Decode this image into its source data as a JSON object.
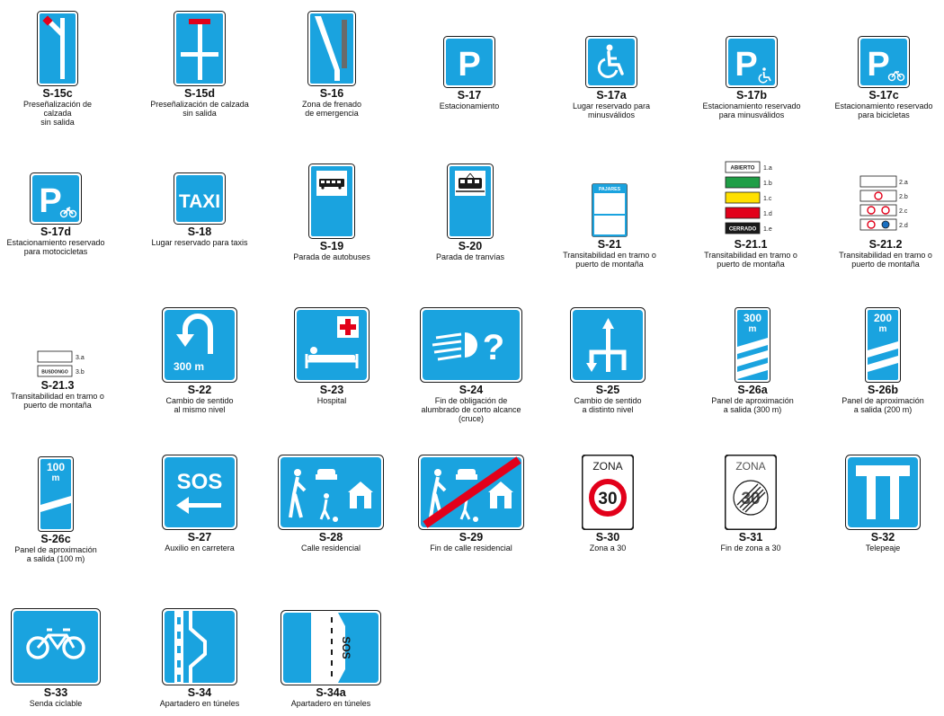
{
  "colors": {
    "sign_blue": "#1aa3df",
    "sign_red": "#e2001a",
    "frame": "#1a1a1a",
    "white": "#ffffff"
  },
  "signs": [
    {
      "id": "s15c",
      "code": "S-15c",
      "desc": "Preseñalización de calzada\nsin salida",
      "icon": "dead-end-branch-icon"
    },
    {
      "id": "s15d",
      "code": "S-15d",
      "desc": "Preseñalización de calzada\nsin salida",
      "icon": "dead-end-cross-icon"
    },
    {
      "id": "s16",
      "code": "S-16",
      "desc": "Zona de frenado\nde emergencia",
      "icon": "emergency-braking-icon"
    },
    {
      "id": "s17",
      "code": "S-17",
      "desc": "Estacionamiento",
      "icon": "parking-icon"
    },
    {
      "id": "s17a",
      "code": "S-17a",
      "desc": "Lugar reservado para\nminusválidos",
      "icon": "wheelchair-icon"
    },
    {
      "id": "s17b",
      "code": "S-17b",
      "desc": "Estacionamiento reservado\npara minusválidos",
      "icon": "parking-wheelchair-icon"
    },
    {
      "id": "s17c",
      "code": "S-17c",
      "desc": "Estacionamiento reservado\npara bicicletas",
      "icon": "parking-bicycle-icon"
    },
    {
      "id": "s17d",
      "code": "S-17d",
      "desc": "Estacionamiento reservado\npara motocicletas",
      "icon": "parking-motorcycle-icon"
    },
    {
      "id": "s18",
      "code": "S-18",
      "desc": "Lugar reservado para taxis",
      "icon": "taxi-icon",
      "text": "TAXI"
    },
    {
      "id": "s19",
      "code": "S-19",
      "desc": "Parada de autobuses",
      "icon": "bus-stop-icon"
    },
    {
      "id": "s20",
      "code": "S-20",
      "desc": "Parada de tranvías",
      "icon": "tram-stop-icon"
    },
    {
      "id": "s21",
      "code": "S-21",
      "desc": "Transitabilidad en tramo o\npuerto de montaña",
      "icon": "mountain-pass-panel-icon",
      "text": "PAJARES"
    },
    {
      "id": "s21_1",
      "code": "S-21.1",
      "desc": "Transitabilidad en tramo o\npuerto de montaña",
      "icon": "pass-status-panels-icon",
      "panels": [
        {
          "label": "1.a",
          "text": "ABIERTO"
        },
        {
          "label": "1.b",
          "text": ""
        },
        {
          "label": "1.c",
          "text": ""
        },
        {
          "label": "1.d",
          "text": ""
        },
        {
          "label": "1.e",
          "text": "CERRADO"
        }
      ]
    },
    {
      "id": "s21_2",
      "code": "S-21.2",
      "desc": "Transitabilidad en tramo o\npuerto de montaña",
      "icon": "pass-restriction-panels-icon",
      "panels": [
        {
          "label": "2.a"
        },
        {
          "label": "2.b"
        },
        {
          "label": "2.c"
        },
        {
          "label": "2.d"
        }
      ]
    },
    {
      "id": "s21_3",
      "code": "S-21.3",
      "desc": "Transitabilidad en tramo o\npuerto de montaña",
      "icon": "pass-info-panels-icon",
      "panels": [
        {
          "label": "3.a",
          "text": ""
        },
        {
          "label": "3.b",
          "text": "BUSDONGO"
        }
      ]
    },
    {
      "id": "s22",
      "code": "S-22",
      "desc": "Cambio de sentido\nal mismo nivel",
      "icon": "u-turn-icon",
      "text": "300 m"
    },
    {
      "id": "s23",
      "code": "S-23",
      "desc": "Hospital",
      "icon": "hospital-bed-icon"
    },
    {
      "id": "s24",
      "code": "S-24",
      "desc": "Fin de obligación de\nalumbrado de corto alcance\n(cruce)",
      "icon": "headlight-end-icon"
    },
    {
      "id": "s25",
      "code": "S-25",
      "desc": "Cambio de sentido\na distinto nivel",
      "icon": "grade-separated-turn-icon"
    },
    {
      "id": "s26a",
      "code": "S-26a",
      "desc": "Panel de aproximación\na salida (300 m)",
      "icon": "exit-countdown-300-icon",
      "text": "300\nm"
    },
    {
      "id": "s26b",
      "code": "S-26b",
      "desc": "Panel de aproximación\na salida (200 m)",
      "icon": "exit-countdown-200-icon",
      "text": "200\nm"
    },
    {
      "id": "s26c",
      "code": "S-26c",
      "desc": "Panel de aproximación\na salida (100 m)",
      "icon": "exit-countdown-100-icon",
      "text": "100\nm"
    },
    {
      "id": "s27",
      "code": "S-27",
      "desc": "Auxilio en carretera",
      "icon": "sos-arrow-icon",
      "text": "SOS"
    },
    {
      "id": "s28",
      "code": "S-28",
      "desc": "Calle residencial",
      "icon": "residential-street-icon"
    },
    {
      "id": "s29",
      "code": "S-29",
      "desc": "Fin de calle residencial",
      "icon": "residential-street-end-icon"
    },
    {
      "id": "s30",
      "code": "S-30",
      "desc": "Zona a 30",
      "icon": "zone-30-icon",
      "text": "ZONA",
      "speed": "30"
    },
    {
      "id": "s31",
      "code": "S-31",
      "desc": "Fin de zona a 30",
      "icon": "zone-30-end-icon",
      "text": "ZONA",
      "speed": "30"
    },
    {
      "id": "s32",
      "code": "S-32",
      "desc": "Telepeaje",
      "icon": "electronic-toll-icon"
    },
    {
      "id": "s33",
      "code": "S-33",
      "desc": "Senda ciclable",
      "icon": "bicycle-path-icon"
    },
    {
      "id": "s34",
      "code": "S-34",
      "desc": "Apartadero en túneles",
      "icon": "tunnel-layby-icon"
    },
    {
      "id": "s34a",
      "code": "S-34a",
      "desc": "Apartadero en túneles",
      "icon": "tunnel-layby-sos-icon",
      "text": "SOS"
    }
  ]
}
